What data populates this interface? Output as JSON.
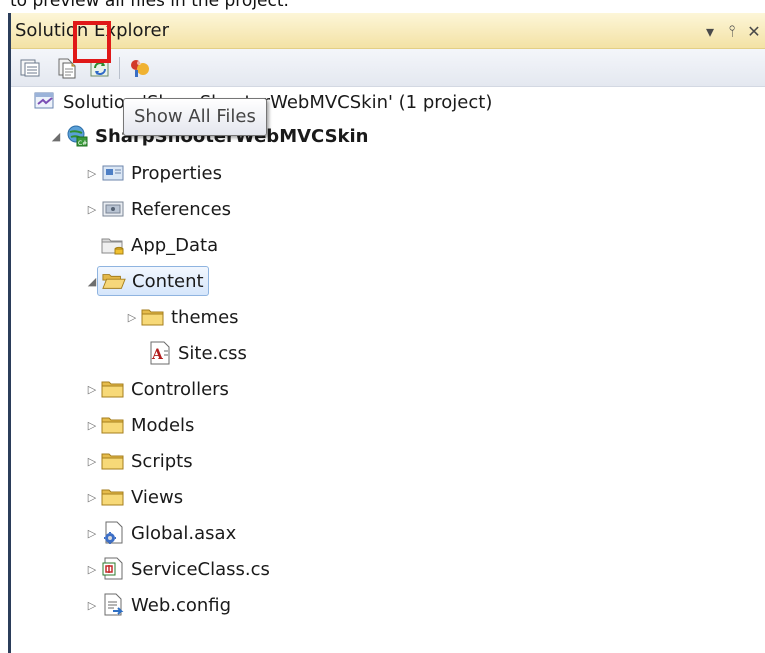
{
  "caption": "to preview all files in the project.",
  "panel": {
    "title": "Solution Explorer",
    "controls": {
      "dropdown": "▾",
      "pin": "⫯",
      "close": "✕"
    }
  },
  "toolbar": {
    "buttons": [
      {
        "name": "properties-icon"
      },
      {
        "name": "show-all-files-icon"
      },
      {
        "name": "refresh-icon"
      },
      {
        "name": "class-view-icon"
      }
    ],
    "highlight_color": "#e01818"
  },
  "tooltip": "Show All Files",
  "tree": {
    "solution": "Solution 'SharpShooterWebMVCSkin' (1 project)",
    "items": [
      {
        "label": "SharpShooterWebMVCSkin",
        "icon": "web-project-icon",
        "toggle": "expanded"
      },
      {
        "label": "Properties",
        "icon": "properties-folder-icon",
        "toggle": "collapsed"
      },
      {
        "label": "References",
        "icon": "references-icon",
        "toggle": "collapsed"
      },
      {
        "label": "App_Data",
        "icon": "app-data-folder-icon",
        "toggle": "none"
      },
      {
        "label": "Content",
        "icon": "open-folder-icon",
        "toggle": "expanded",
        "selected": true
      },
      {
        "label": "themes",
        "icon": "folder-icon",
        "toggle": "collapsed"
      },
      {
        "label": "Site.css",
        "icon": "css-file-icon",
        "toggle": "none"
      },
      {
        "label": "Controllers",
        "icon": "folder-icon",
        "toggle": "collapsed"
      },
      {
        "label": "Models",
        "icon": "folder-icon",
        "toggle": "collapsed"
      },
      {
        "label": "Scripts",
        "icon": "folder-icon",
        "toggle": "collapsed"
      },
      {
        "label": "Views",
        "icon": "folder-icon",
        "toggle": "collapsed"
      },
      {
        "label": "Global.asax",
        "icon": "asax-file-icon",
        "toggle": "collapsed"
      },
      {
        "label": "ServiceClass.cs",
        "icon": "cs-file-icon",
        "toggle": "collapsed"
      },
      {
        "label": "Web.config",
        "icon": "config-file-icon",
        "toggle": "collapsed"
      }
    ]
  }
}
